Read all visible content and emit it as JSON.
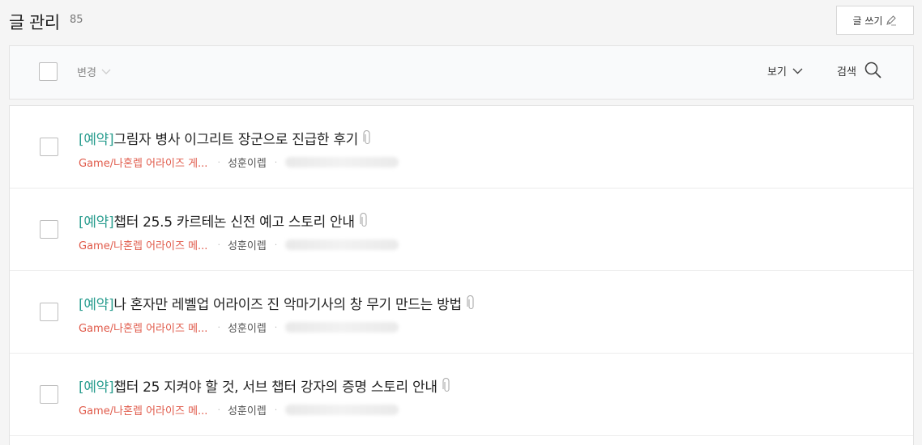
{
  "header": {
    "title": "글 관리",
    "count": "85",
    "write_label": "글 쓰기"
  },
  "toolbar": {
    "change_label": "변경",
    "view_label": "보기",
    "search_label": "검색"
  },
  "posts": [
    {
      "tag": "[예약]",
      "title": "그림자 병사 이그리트 장군으로 진급한 후기",
      "category": "Game/나혼렙 어라이즈 게...",
      "author": "성훈이렙",
      "has_attachment": true
    },
    {
      "tag": "[예약]",
      "title": "챕터 25.5 카르테논 신전 예고 스토리 안내",
      "category": "Game/나혼렙 어라이즈 메...",
      "author": "성훈이렙",
      "has_attachment": true
    },
    {
      "tag": "[예약]",
      "title": "나 혼자만 레벨업 어라이즈 진 악마기사의 창 무기 만드는 방법",
      "category": "Game/나혼렙 어라이즈 메...",
      "author": "성훈이렙",
      "has_attachment": true
    },
    {
      "tag": "[예약]",
      "title": "챕터 25 지켜야 할 것, 서브 챕터 강자의 증명 스토리 안내",
      "category": "Game/나혼렙 어라이즈 메...",
      "author": "성훈이렙",
      "has_attachment": true
    }
  ],
  "icons": {
    "write": "pencil-icon",
    "change_dropdown": "chevron-down-icon",
    "view_dropdown": "chevron-down-icon",
    "search": "search-icon",
    "attachment": "paperclip-icon"
  },
  "colors": {
    "tag": "#2a9d8f",
    "category": "#e05a4a"
  }
}
